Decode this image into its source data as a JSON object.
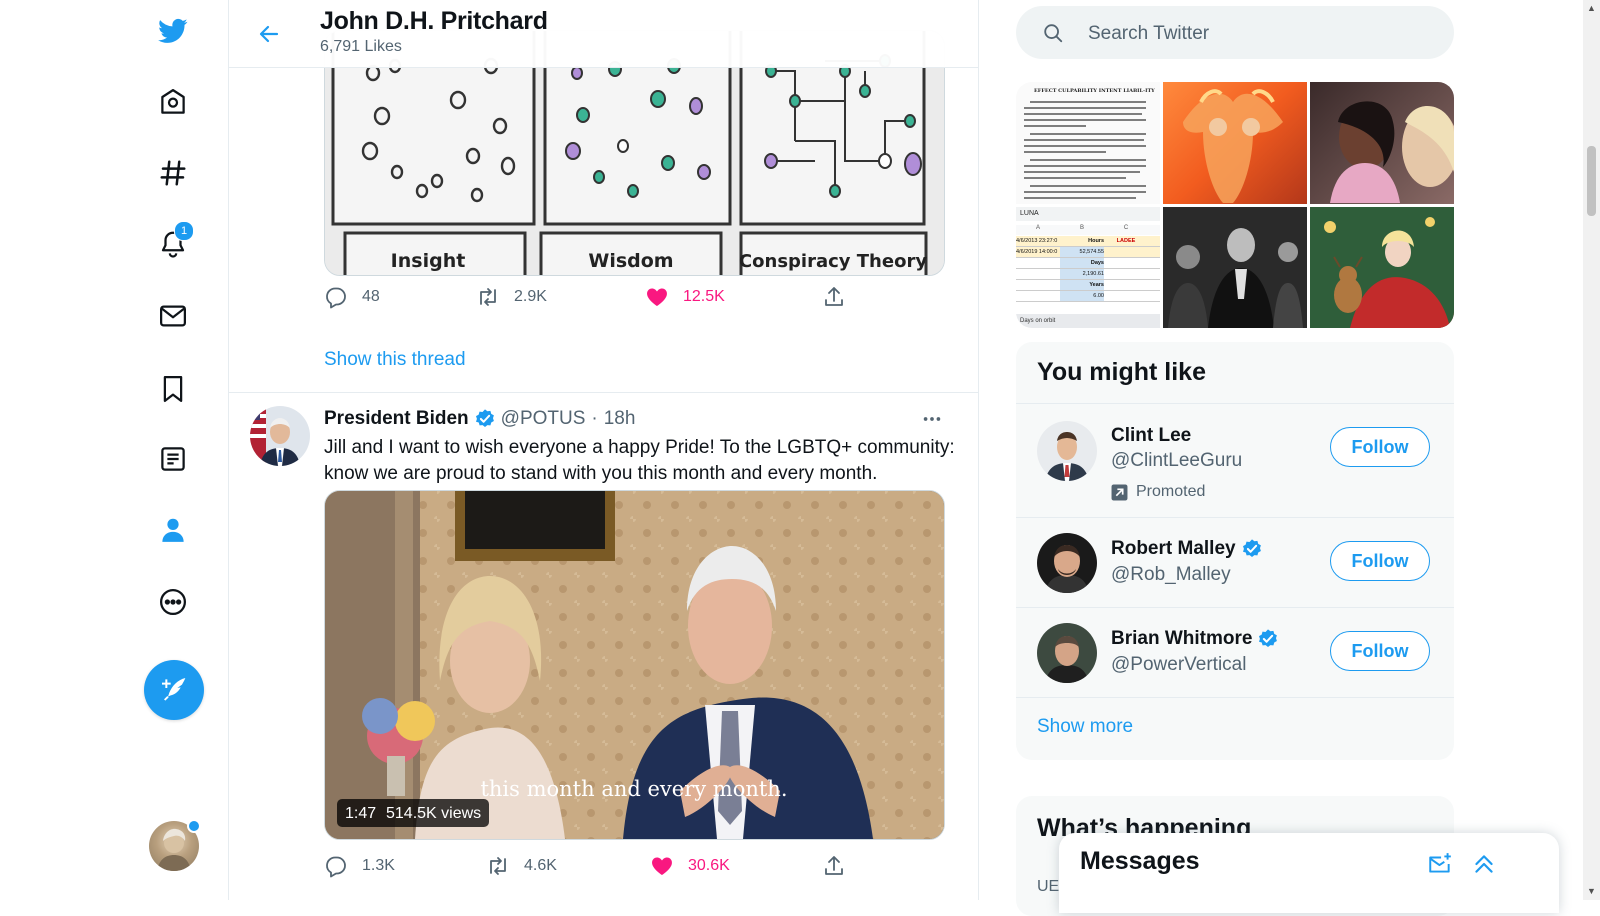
{
  "header": {
    "title": "John D.H. Pritchard",
    "subtitle": "6,791 Likes"
  },
  "nav": {
    "notifications_badge": "1",
    "icons": [
      "twitter-logo-icon",
      "home-icon",
      "explore-icon",
      "notifications-icon",
      "messages-icon",
      "bookmarks-icon",
      "lists-icon",
      "profile-icon",
      "more-icon",
      "compose-icon"
    ]
  },
  "tweet1": {
    "panels": [
      "Insight",
      "Wisdom",
      "Conspiracy Theory"
    ],
    "actions": {
      "replies": "48",
      "retweets": "2.9K",
      "likes": "12.5K"
    },
    "show_thread": "Show this thread"
  },
  "tweet2": {
    "name": "President Biden",
    "handle": "@POTUS",
    "dot": "·",
    "time": "18h",
    "text": "Jill and I want to wish everyone a happy Pride! To the LGBTQ+ community: know we are proud to stand with you this month and every month.",
    "video": {
      "caption": "this month and every month.",
      "duration": "1:47",
      "views": "514.5K views"
    },
    "actions": {
      "replies": "1.3K",
      "retweets": "4.6K",
      "likes": "30.6K"
    }
  },
  "search": {
    "placeholder": "Search Twitter"
  },
  "media_grid": {
    "doc_heading": "EFFECT CULPABILITY INTENT LIABIL-ITY",
    "sheet": {
      "name": "LUNA",
      "cols": [
        "A",
        "B",
        "C"
      ],
      "rows": [
        [
          "4/6/2013 23:27:0",
          "Hours",
          "LADEE"
        ],
        [
          "4/6/2019 14:00:0",
          "52,574.55",
          ""
        ],
        [
          "",
          "Days",
          ""
        ],
        [
          "",
          "2,190.61",
          ""
        ],
        [
          "",
          "Years",
          ""
        ],
        [
          "",
          "6.00",
          ""
        ]
      ],
      "tab": "Days on orbit"
    }
  },
  "who_to_follow": {
    "title": "You might like",
    "promoted_label": "Promoted",
    "follow_label": "Follow",
    "show_more": "Show more",
    "users": [
      {
        "name": "Clint Lee",
        "handle": "@ClintLeeGuru",
        "verified": false,
        "promoted": true
      },
      {
        "name": "Robert Malley",
        "handle": "@Rob_Malley",
        "verified": true,
        "promoted": false
      },
      {
        "name": "Brian Whitmore",
        "handle": "@PowerVertical",
        "verified": true,
        "promoted": false
      }
    ]
  },
  "trends": {
    "title": "What’s happening",
    "first_item_fragment": "UE"
  },
  "messages": {
    "title": "Messages"
  },
  "colors": {
    "accent": "#1d9bf0",
    "like": "#f91880",
    "text": "#0f1419",
    "muted": "#536471",
    "border": "#e6ecf0"
  }
}
